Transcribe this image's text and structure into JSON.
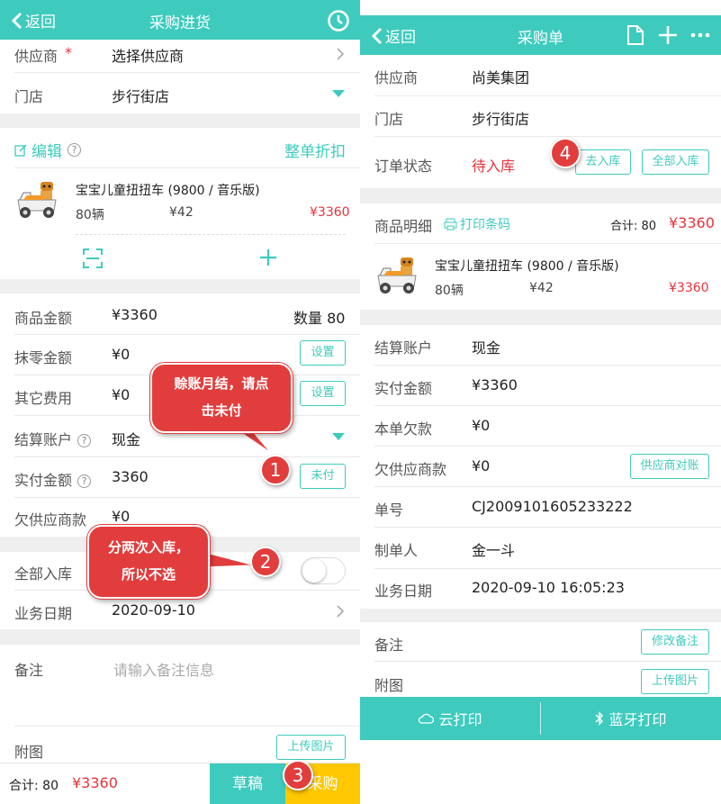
{
  "left": {
    "header": {
      "back": "返回",
      "title": "采购进货"
    },
    "supplier": {
      "label": "供应商",
      "required_mark": "*",
      "value": "选择供应商"
    },
    "store": {
      "label": "门店",
      "value": "步行街店"
    },
    "items_bar": {
      "edit": "编辑",
      "discount": "整单折扣"
    },
    "product": {
      "name": "宝宝儿童扭扭车 (9800 / 音乐版)",
      "qty": "80辆",
      "price": "¥42",
      "total": "¥3360"
    },
    "summary": {
      "goods_amount_label": "商品金额",
      "goods_amount": "¥3360",
      "qty_label": "数量 80",
      "rounding_label": "抹零金额",
      "rounding": "¥0",
      "rounding_btn": "设置",
      "other_label": "其它费用",
      "other": "¥0",
      "other_btn": "设置",
      "account_label": "结算账户",
      "account": "现金",
      "paid_label": "实付金额",
      "paid": "3360",
      "unpaid_btn": "未付",
      "owe_label": "欠供应商款",
      "owe": "¥0"
    },
    "all_in_label": "全部入库",
    "date": {
      "label": "业务日期",
      "value": "2020-09-10"
    },
    "remark": {
      "label": "备注",
      "placeholder": "请输入备注信息"
    },
    "attach": {
      "label": "附图",
      "btn": "上传图片"
    },
    "footer": {
      "total_label": "合计: 80",
      "total_amount": "¥3360",
      "draft": "草稿",
      "purchase": "采购"
    },
    "callouts": {
      "c1_line1": "赊账月结，请点",
      "c1_line2": "击未付",
      "c2_line1": "分两次入库，",
      "c2_line2": "所以不选"
    },
    "numbers": {
      "n1": "1",
      "n2": "2",
      "n3": "3"
    }
  },
  "right": {
    "header": {
      "back": "返回",
      "title": "采购单"
    },
    "supplier": {
      "label": "供应商",
      "value": "尚美集团"
    },
    "store": {
      "label": "门店",
      "value": "步行街店"
    },
    "status": {
      "label": "订单状态",
      "value": "待入库",
      "btn1": "去入库",
      "btn2": "全部入库"
    },
    "detail": {
      "label": "商品明细",
      "print_barcode": "打印条码",
      "total_label": "合计: 80",
      "total": "¥3360"
    },
    "product": {
      "name": "宝宝儿童扭扭车 (9800 / 音乐版)",
      "qty": "80辆",
      "price": "¥42",
      "total": "¥3360"
    },
    "info": {
      "account_label": "结算账户",
      "account": "现金",
      "paid_label": "实付金额",
      "paid": "¥3360",
      "owe_label": "本单欠款",
      "owe": "¥0",
      "owe_supplier_label": "欠供应商款",
      "owe_supplier": "¥0",
      "reconcile_btn": "供应商对账",
      "no_label": "单号",
      "no": "CJ2009101605233222",
      "maker_label": "制单人",
      "maker": "金一斗",
      "date_label": "业务日期",
      "date": "2020-09-10 16:05:23"
    },
    "remark": {
      "label": "备注",
      "btn": "修改备注"
    },
    "attach": {
      "label": "附图",
      "btn": "上传图片"
    },
    "footer": {
      "cloud_print": "云打印",
      "bt_print": "蓝牙打印"
    },
    "numbers": {
      "n4": "4"
    }
  },
  "colors": {
    "accent": "#3ecbbe",
    "red": "#e8343b",
    "yellow": "#ffc800",
    "callout": "#e23d3d"
  }
}
